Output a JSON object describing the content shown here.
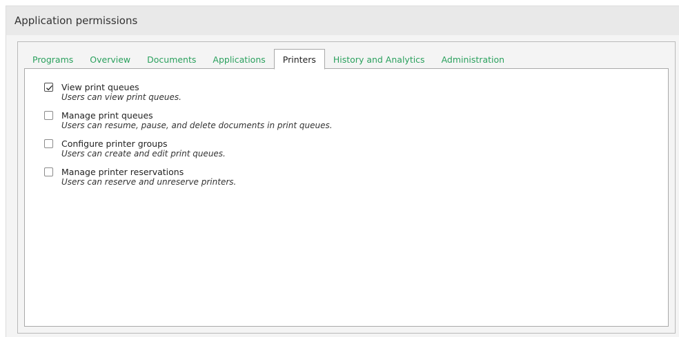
{
  "header": {
    "title": "Application permissions"
  },
  "tabs": [
    {
      "label": "Programs",
      "active": false
    },
    {
      "label": "Overview",
      "active": false
    },
    {
      "label": "Documents",
      "active": false
    },
    {
      "label": "Applications",
      "active": false
    },
    {
      "label": "Printers",
      "active": true
    },
    {
      "label": "History and Analytics",
      "active": false
    },
    {
      "label": "Administration",
      "active": false
    }
  ],
  "permissions": [
    {
      "label": "View print queues",
      "description": "Users can view print queues.",
      "checked": true
    },
    {
      "label": "Manage print queues",
      "description": "Users can resume, pause, and delete documents in print queues.",
      "checked": false
    },
    {
      "label": "Configure printer groups",
      "description": "Users can create and edit print queues.",
      "checked": false
    },
    {
      "label": "Manage printer reservations",
      "description": "Users can reserve and unreserve printers.",
      "checked": false
    }
  ],
  "colors": {
    "tab_link": "#2aa05d",
    "header_bg": "#e9e9e9"
  }
}
